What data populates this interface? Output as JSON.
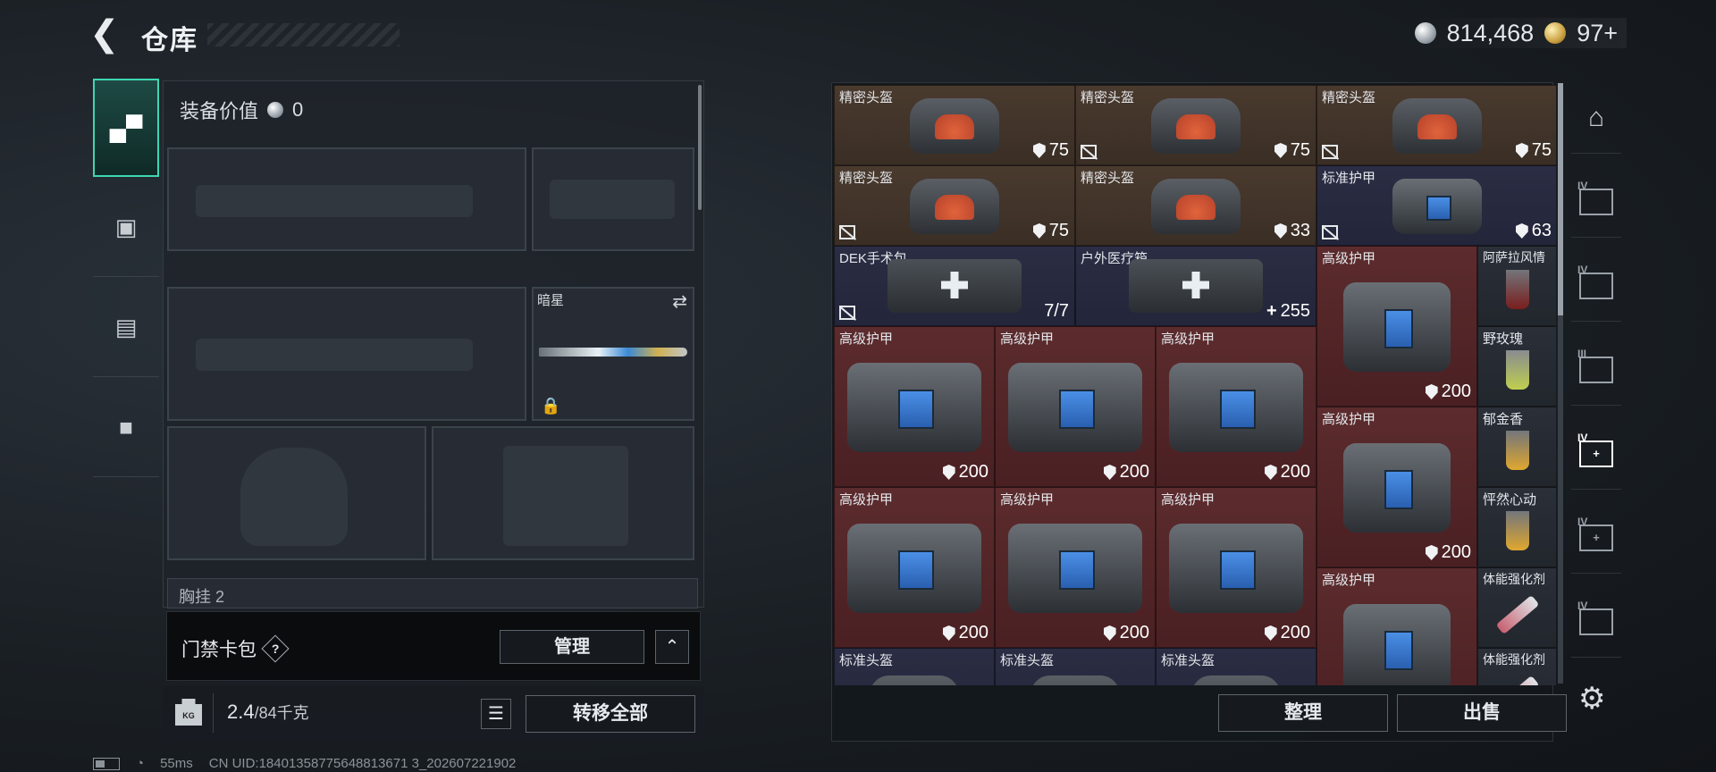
{
  "header": {
    "back_icon": "chevron-left-icon",
    "title": "仓库",
    "currency_silver": "814,468",
    "currency_gold": "97+"
  },
  "left_tabs": [
    {
      "name": "weapons",
      "icon": "pistol-icon",
      "active": true
    },
    {
      "name": "armor",
      "icon": "vest-icon",
      "active": false
    },
    {
      "name": "backpack",
      "icon": "backpack-icon",
      "active": false
    },
    {
      "name": "case",
      "icon": "briefcase-icon",
      "active": false
    }
  ],
  "equipment": {
    "value_label": "装备价值",
    "value": "0",
    "melee_name": "暗星",
    "chest_label": "胸挂",
    "chest_count": "2"
  },
  "card_pack": {
    "label": "门禁卡包",
    "help": "?",
    "manage": "管理"
  },
  "bottom": {
    "weight": "2.4",
    "weight_max": "/84千克",
    "transfer_all": "转移全部",
    "kg_badge": "KG"
  },
  "status": {
    "ping": "55ms",
    "uid": "CN UID:18401358775648813671 3_202607221902"
  },
  "inventory": {
    "items": [
      {
        "name": "精密头盔",
        "value": "75",
        "icon": "shield",
        "nodrop": false
      },
      {
        "name": "精密头盔",
        "value": "75",
        "icon": "shield",
        "nodrop": true
      },
      {
        "name": "精密头盔",
        "value": "75",
        "icon": "shield",
        "nodrop": true
      },
      {
        "name": "精密头盔",
        "value": "75",
        "icon": "shield",
        "nodrop": true
      },
      {
        "name": "精密头盔",
        "value": "33",
        "icon": "shield",
        "nodrop": false
      },
      {
        "name": "标准护甲",
        "value": "63",
        "icon": "shield",
        "nodrop": true
      },
      {
        "name": "DEK手术包",
        "value": "7/7",
        "icon": "",
        "nodrop": true
      },
      {
        "name": "户外医疗箱",
        "value": "255",
        "icon": "plus",
        "nodrop": false
      },
      {
        "name": "高级护甲",
        "value": "200",
        "icon": "shield",
        "nodrop": false
      },
      {
        "name": "阿萨拉风情",
        "value": "",
        "icon": "",
        "nodrop": false
      },
      {
        "name": "高级护甲",
        "value": "200",
        "icon": "shield",
        "nodrop": false
      },
      {
        "name": "高级护甲",
        "value": "200",
        "icon": "shield",
        "nodrop": false
      },
      {
        "name": "高级护甲",
        "value": "200",
        "icon": "shield",
        "nodrop": false
      },
      {
        "name": "野玫瑰",
        "value": "",
        "icon": "",
        "nodrop": false
      },
      {
        "name": "高级护甲",
        "value": "200",
        "icon": "shield",
        "nodrop": false
      },
      {
        "name": "郁金香",
        "value": "",
        "icon": "",
        "nodrop": false
      },
      {
        "name": "高级护甲",
        "value": "200",
        "icon": "shield",
        "nodrop": false
      },
      {
        "name": "高级护甲",
        "value": "200",
        "icon": "shield",
        "nodrop": false
      },
      {
        "name": "高级护甲",
        "value": "200",
        "icon": "shield",
        "nodrop": false
      },
      {
        "name": "怦然心动",
        "value": "",
        "icon": "",
        "nodrop": false
      },
      {
        "name": "高级护甲",
        "value": "200",
        "icon": "shield",
        "nodrop": false
      },
      {
        "name": "体能强化剂",
        "value": "",
        "icon": "",
        "nodrop": false
      },
      {
        "name": "标准头盔",
        "value": "",
        "icon": "",
        "nodrop": false
      },
      {
        "name": "标准头盔",
        "value": "",
        "icon": "",
        "nodrop": false
      },
      {
        "name": "标准头盔",
        "value": "",
        "icon": "",
        "nodrop": false
      },
      {
        "name": "体能强化剂",
        "value": "",
        "icon": "",
        "nodrop": false
      }
    ],
    "sort": "整理",
    "sell": "出售"
  },
  "right_tabs": [
    {
      "icon": "safe-box-icon",
      "level": ""
    },
    {
      "icon": "storage-expand-icon",
      "level": "IV"
    },
    {
      "icon": "storage-expand-icon",
      "level": "IV"
    },
    {
      "icon": "storage-expand-icon",
      "level": "III"
    },
    {
      "icon": "storage-add-icon",
      "level": "IV",
      "active": true
    },
    {
      "icon": "storage-add-icon",
      "level": "IV"
    },
    {
      "icon": "storage-expand-icon",
      "level": "IV"
    }
  ],
  "settings_icon": "gear-icon"
}
